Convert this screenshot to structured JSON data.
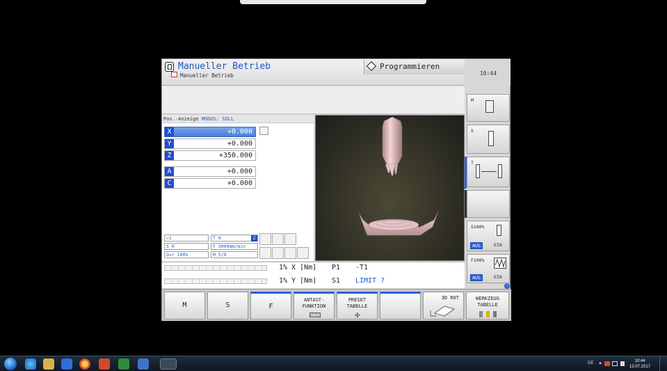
{
  "window": {
    "title": "Manueller Betrieb",
    "subtitle": "Manueller Betrieb",
    "programming_tab": "Programmieren",
    "clock": "10:44"
  },
  "position_display": {
    "header_label": "Pos.-Anzeige",
    "header_mode": "MODUS: SOLL",
    "axes": [
      {
        "letter": "X",
        "value": "+0.000"
      },
      {
        "letter": "Y",
        "value": "+0.000"
      },
      {
        "letter": "Z",
        "value": "+350.000"
      },
      {
        "letter": "A",
        "value": "+0.000"
      },
      {
        "letter": "C",
        "value": "+0.000"
      }
    ]
  },
  "status": {
    "datum": "1",
    "tool": "T 0",
    "tool_axis": "Z",
    "spindle": "S 0",
    "feed": "F 3000mm/min",
    "override": "Ovr 100%",
    "mfunc": "M 5/9"
  },
  "info_rows": {
    "row1_pct": "1% X [Nm]",
    "row1_p": "P1",
    "row1_t": "-T1",
    "row2_pct": "1% Y [Nm]",
    "row2_s": "S1",
    "row2_limit": "LIMIT ?"
  },
  "side_softkeys": {
    "m_label": "M",
    "s_label": "S",
    "t_label": "T",
    "s100_label": "S100%",
    "f100_label": "F100%",
    "aus": "AUS",
    "ein": "EIN"
  },
  "softkeys": {
    "m": "M",
    "s": "S",
    "f": "F",
    "antast_1": "ANTAST-",
    "antast_2": "FUNKTION",
    "preset_1": "PRESET",
    "preset_2": "TABELLE",
    "rot_3d": "3D ROT",
    "werkzeug_1": "WERKZEUG",
    "werkzeug_2": "TABELLE"
  },
  "taskbar": {
    "lang": "DE",
    "time": "10:44",
    "date": "13.07.2017"
  }
}
